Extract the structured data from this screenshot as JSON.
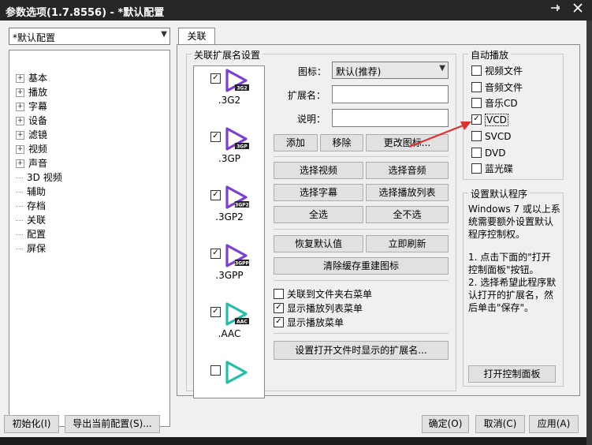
{
  "window": {
    "title": "参数选项(1.7.8556) - *默认配置",
    "pin_icon": "pin-icon",
    "close_icon": "close-icon"
  },
  "profile_select": {
    "value": "*默认配置"
  },
  "tree": [
    {
      "label": "基本",
      "expandable": true
    },
    {
      "label": "播放",
      "expandable": true
    },
    {
      "label": "字幕",
      "expandable": true
    },
    {
      "label": "设备",
      "expandable": true
    },
    {
      "label": "滤镜",
      "expandable": true
    },
    {
      "label": "视频",
      "expandable": true
    },
    {
      "label": "声音",
      "expandable": true
    },
    {
      "label": "3D 视频",
      "expandable": false
    },
    {
      "label": "辅助",
      "expandable": false
    },
    {
      "label": "存档",
      "expandable": false
    },
    {
      "label": "关联",
      "expandable": false
    },
    {
      "label": "配置",
      "expandable": false
    },
    {
      "label": "屏保",
      "expandable": false
    }
  ],
  "tab": {
    "label": "关联"
  },
  "assoc": {
    "group_label": "关联扩展名设置",
    "items": [
      {
        "ext": ".3G2",
        "badge": "3G2",
        "checked": true,
        "color": "#7b3fd6"
      },
      {
        "ext": ".3GP",
        "badge": "3GP",
        "checked": true,
        "color": "#7b3fd6"
      },
      {
        "ext": ".3GP2",
        "badge": "3GP2",
        "checked": true,
        "color": "#7b3fd6"
      },
      {
        "ext": ".3GPP",
        "badge": "3GPP",
        "checked": true,
        "color": "#7b3fd6"
      },
      {
        "ext": ".AAC",
        "badge": "AAC",
        "checked": true,
        "color": "#1fbfa8"
      },
      {
        "ext": "",
        "badge": "",
        "checked": false,
        "color": "#1fbfa8"
      }
    ],
    "icon_label": "图标：",
    "icon_value": "默认(推荐)",
    "ext_label": "扩展名：",
    "desc_label": "说明：",
    "btn_add": "添加",
    "btn_remove": "移除",
    "btn_change_icon": "更改图标...",
    "btn_sel_video": "选择视频",
    "btn_sel_audio": "选择音频",
    "btn_sel_sub": "选择字幕",
    "btn_sel_playlist": "选择播放列表",
    "btn_select_all": "全选",
    "btn_select_none": "全不选",
    "btn_restore": "恢复默认值",
    "btn_refresh": "立即刷新",
    "btn_clear_cache": "清除缓存重建图标",
    "chk_folder_menu": "关联到文件夹右菜单",
    "chk_folder_menu_checked": false,
    "chk_playlist_menu": "显示播放列表菜单",
    "chk_playlist_menu_checked": true,
    "chk_play_menu": "显示播放菜单",
    "chk_play_menu_checked": true,
    "btn_set_ext": "设置打开文件时显示的扩展名..."
  },
  "autoplay": {
    "group_label": "自动播放",
    "items": [
      {
        "label": "视频文件",
        "checked": false
      },
      {
        "label": "音频文件",
        "checked": false
      },
      {
        "label": "音乐CD",
        "checked": false
      },
      {
        "label": "VCD",
        "checked": true
      },
      {
        "label": "SVCD",
        "checked": false
      },
      {
        "label": "DVD",
        "checked": false
      },
      {
        "label": "蓝光碟",
        "checked": false
      }
    ]
  },
  "default_program": {
    "group_label": "设置默认程序",
    "text1": [
      "Windows 7 或以上系",
      "统需要额外设置默认",
      "程序控制权。"
    ],
    "text2": [
      "1. 点击下面的\"打开",
      "控制面板\"按钮。",
      "2. 选择希望此程序默",
      "认打开的扩展名，然",
      "后单击\"保存\"。"
    ],
    "btn_open_cp": "打开控制面板"
  },
  "footer": {
    "btn_init": "初始化(I)",
    "btn_export": "导出当前配置(S)...",
    "btn_ok": "确定(O)",
    "btn_cancel": "取消(C)",
    "btn_apply": "应用(A)"
  },
  "annotation_color": "#e03030"
}
